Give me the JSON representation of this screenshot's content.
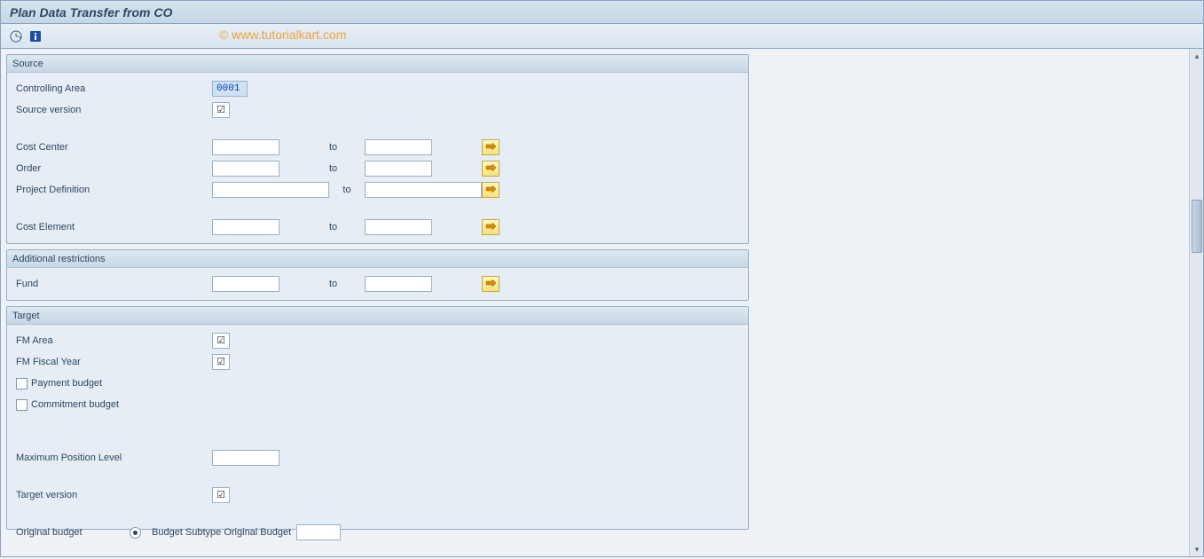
{
  "page": {
    "title": "Plan Data Transfer from CO",
    "watermark": "© www.tutorialkart.com"
  },
  "source": {
    "header": "Source",
    "controlling_area": {
      "label": "Controlling Area",
      "value": "0001"
    },
    "source_version": {
      "label": "Source version",
      "value": ""
    },
    "to_text": "to",
    "cost_center": {
      "label": "Cost Center",
      "from": "",
      "to": ""
    },
    "order": {
      "label": "Order",
      "from": "",
      "to": ""
    },
    "project_definition": {
      "label": "Project Definition",
      "from": "",
      "to": ""
    },
    "cost_element": {
      "label": "Cost Element",
      "from": "",
      "to": ""
    }
  },
  "addl": {
    "header": "Additional restrictions",
    "to_text": "to",
    "fund": {
      "label": "Fund",
      "from": "",
      "to": ""
    }
  },
  "target": {
    "header": "Target",
    "fm_area": {
      "label": "FM Area",
      "value": ""
    },
    "fm_fiscal_year": {
      "label": "FM Fiscal Year",
      "value": ""
    },
    "payment_budget": {
      "label": "Payment budget",
      "checked": false
    },
    "commitment_budget": {
      "label": "Commitment budget",
      "checked": false
    },
    "max_position_level": {
      "label": "Maximum Position Level",
      "value": ""
    },
    "target_version": {
      "label": "Target version",
      "value": ""
    },
    "original_budget": {
      "label": "Original budget",
      "selected": true,
      "subtype_label": "Budget Subtype Original Budget",
      "subtype_value": ""
    }
  }
}
